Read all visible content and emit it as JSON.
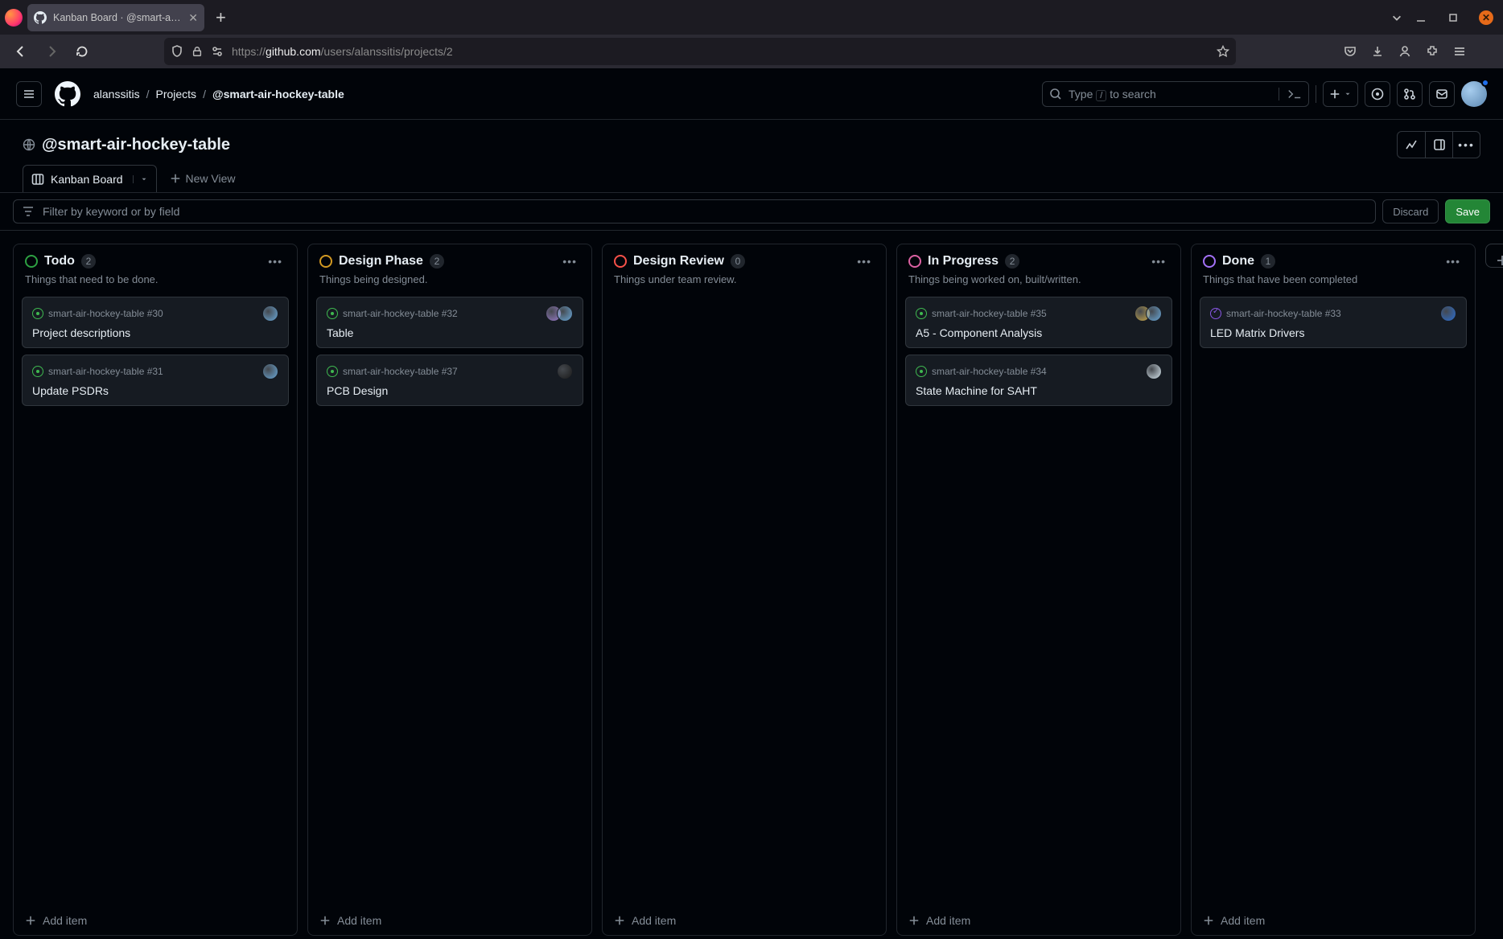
{
  "browser": {
    "tab_title": "Kanban Board · @smart-air…",
    "url_prefix": "https://",
    "url_host": "github.com",
    "url_path": "/users/alanssitis/projects/2"
  },
  "header": {
    "breadcrumb": {
      "owner": "alanssitis",
      "projects": "Projects",
      "current": "@smart-air-hockey-table"
    },
    "search_hint_pre": "Type ",
    "search_hint_key": "/",
    "search_hint_post": " to search"
  },
  "project": {
    "title": "@smart-air-hockey-table"
  },
  "views": {
    "active_tab": "Kanban Board",
    "new_view_label": "New View"
  },
  "filter": {
    "placeholder": "Filter by keyword or by field",
    "discard_label": "Discard",
    "save_label": "Save"
  },
  "board": {
    "add_item_label": "Add item",
    "columns": [
      {
        "id": "todo",
        "title": "Todo",
        "count": "2",
        "description": "Things that need to be done.",
        "color": "#2da042",
        "cards": [
          {
            "repo": "smart-air-hockey-table",
            "number": "#30",
            "title": "Project descriptions",
            "status": "open",
            "assignees": [
              "#6aa8d8"
            ]
          },
          {
            "repo": "smart-air-hockey-table",
            "number": "#31",
            "title": "Update PSDRs",
            "status": "open",
            "assignees": [
              "#6aa8d8"
            ]
          }
        ]
      },
      {
        "id": "design-phase",
        "title": "Design Phase",
        "count": "2",
        "description": "Things being designed.",
        "color": "#d29922",
        "cards": [
          {
            "repo": "smart-air-hockey-table",
            "number": "#32",
            "title": "Table",
            "status": "open",
            "assignees": [
              "#9a7ccc",
              "#6aa8d8"
            ]
          },
          {
            "repo": "smart-air-hockey-table",
            "number": "#37",
            "title": "PCB Design",
            "status": "open",
            "assignees": [
              "#1a1a1a"
            ]
          }
        ]
      },
      {
        "id": "design-review",
        "title": "Design Review",
        "count": "0",
        "description": "Things under team review.",
        "color": "#f85149",
        "cards": []
      },
      {
        "id": "in-progress",
        "title": "In Progress",
        "count": "2",
        "description": "Things being worked on, built/written.",
        "color": "#db61a2",
        "cards": [
          {
            "repo": "smart-air-hockey-table",
            "number": "#35",
            "title": "A5 - Component Analysis",
            "status": "open",
            "assignees": [
              "#c9a94a",
              "#6aa8d8"
            ]
          },
          {
            "repo": "smart-air-hockey-table",
            "number": "#34",
            "title": "State Machine for SAHT",
            "status": "open",
            "assignees": [
              "#d7e6ee"
            ]
          }
        ]
      },
      {
        "id": "done",
        "title": "Done",
        "count": "1",
        "description": "Things that have been completed",
        "color": "#a371f7",
        "cards": [
          {
            "repo": "smart-air-hockey-table",
            "number": "#33",
            "title": "LED Matrix Drivers",
            "status": "done",
            "assignees": [
              "#2c6fd1"
            ]
          }
        ]
      }
    ]
  }
}
